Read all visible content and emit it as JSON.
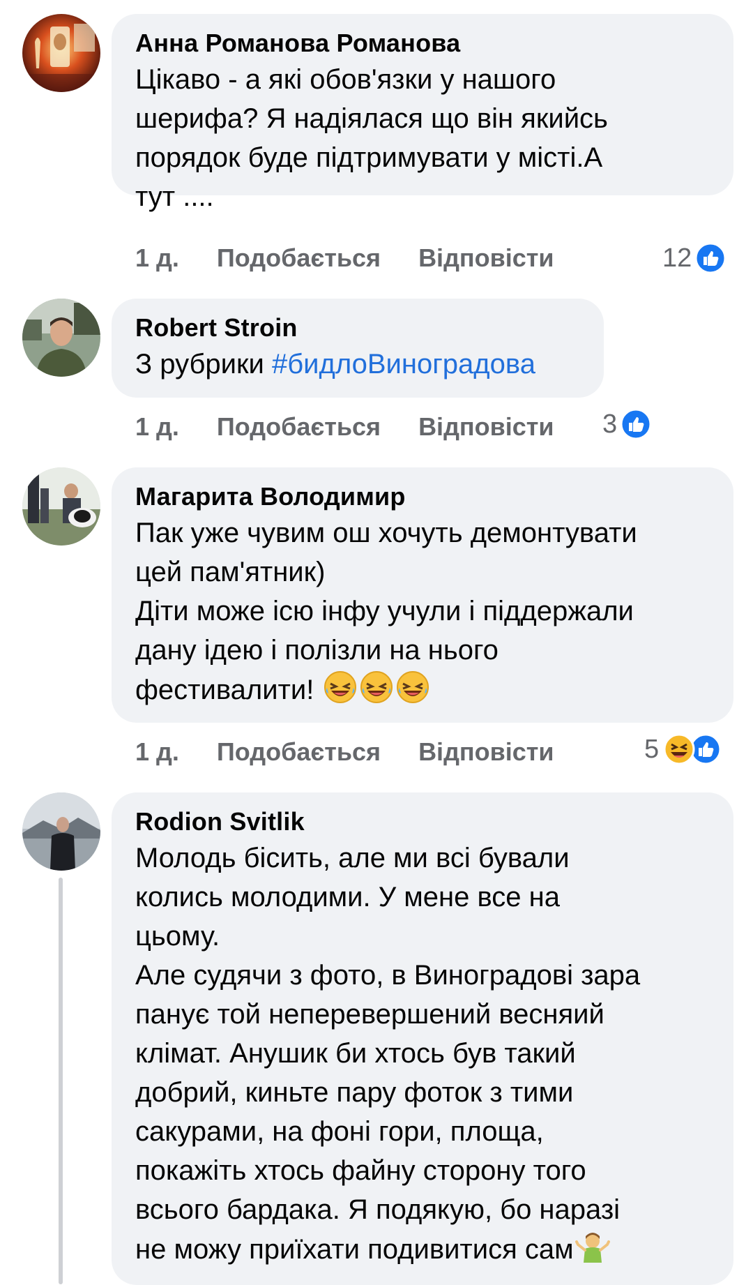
{
  "comments": [
    {
      "author": "Анна Романова Романова",
      "text": "Цікаво - а які обов'язки у нашого\nшерифа? Я надіялася що він якийсь\nпорядок буде підтримувати у місті.А\nтут ....",
      "time": "1 д.",
      "like_label": "Подобається",
      "reply_label": "Відповісти",
      "reaction_count": "12",
      "reactions": [
        "like-icon"
      ]
    },
    {
      "author": "Robert Stroin",
      "text_prefix": "З рубрики ",
      "hashtag": "#бидлоВиноградова",
      "time": "1 д.",
      "like_label": "Подобається",
      "reply_label": "Відповісти",
      "reaction_count": "3",
      "reactions": [
        "like-icon"
      ]
    },
    {
      "author": "Магарита Володимир",
      "text": "Пак уже чувим ош хочуть демонтувати\nцей пам'ятник)\nДіти може ісю інфу учули і піддержали\nдану ідею і полізли на нього\nфестивалити! ",
      "emoji": [
        "rolling-laughing-emoji",
        "rolling-laughing-emoji",
        "rolling-laughing-emoji"
      ],
      "time": "1 д.",
      "like_label": "Подобається",
      "reply_label": "Відповісти",
      "reaction_count": "5",
      "reactions": [
        "haha-icon",
        "like-icon"
      ]
    },
    {
      "author": "Rodion Svitlik",
      "text": "Молодь бісить, але ми всі бували\nколись молодими. У мене все на\nцьому.\nАле судячи з фото, в Виноградові зара\nпанує той неперевершений весняий\nклімат. Анушик би хтось був такий\nдобрий, киньте пару фоток з тими\nсакурами, на фоні гори, площа,\nпокажіть хтось файну сторону того\nвсього бардака. Я подякую, бо наразі\nне можу приїхати подивитися сам",
      "emoji": [
        "person-shrugging-emoji"
      ]
    }
  ],
  "colors": {
    "bubble": "#f0f2f5",
    "meta": "#65676b",
    "hashtag": "#216fdb",
    "like_blue": "#1877f2",
    "thread_line": "#ced0d4"
  }
}
